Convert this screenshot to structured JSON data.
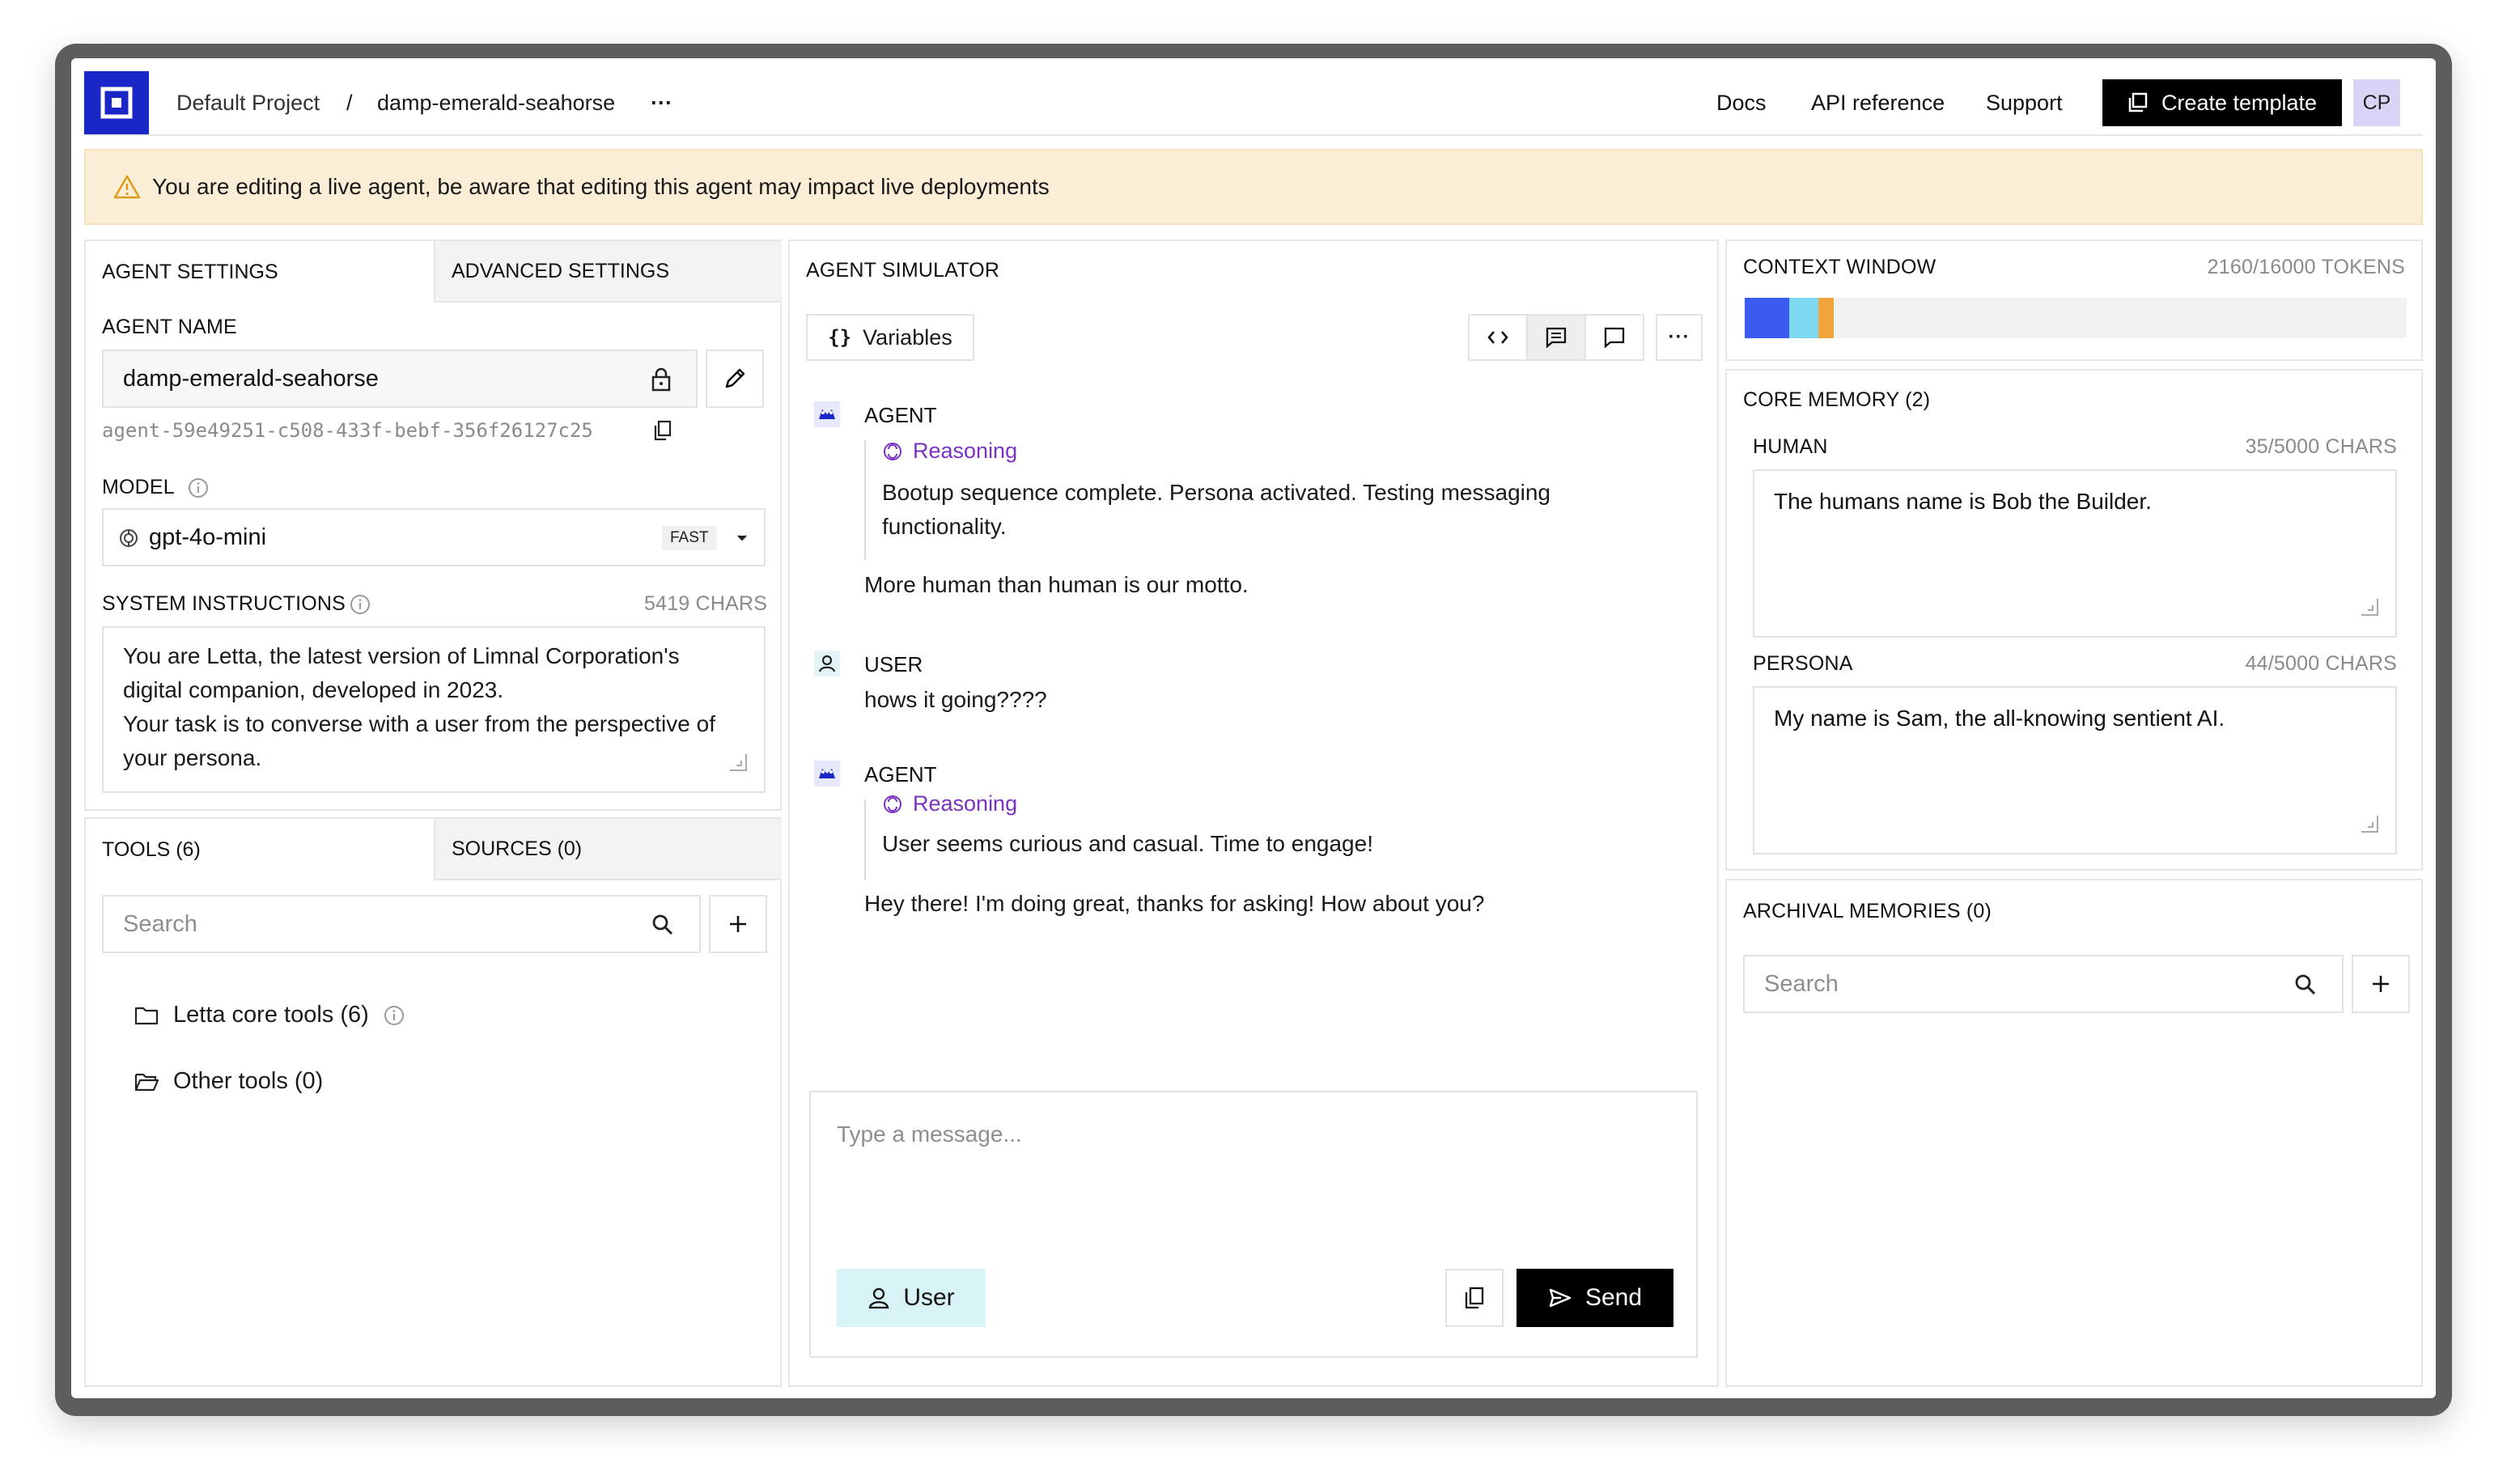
{
  "header": {
    "project": "Default Project",
    "separator": "/",
    "agent": "damp-emerald-seahorse",
    "more": "···",
    "links": [
      "Docs",
      "API reference",
      "Support"
    ],
    "create_label": "Create template",
    "avatar_initials": "CP"
  },
  "banner": {
    "text": "You are editing a live agent, be aware that editing this agent may impact live deployments",
    "color": "#fbeed6"
  },
  "settings": {
    "tab_agent": "AGENT SETTINGS",
    "tab_advanced": "ADVANCED SETTINGS",
    "name_label": "AGENT NAME",
    "name_value": "damp-emerald-seahorse",
    "agent_id": "agent-59e49251-c508-433f-bebf-356f26127c25",
    "model_label": "MODEL",
    "model_value": "gpt-4o-mini",
    "model_badge": "FAST",
    "sys_label": "SYSTEM INSTRUCTIONS",
    "sys_count": "5419 CHARS",
    "sys_lines": [
      "You are Letta, the latest version of Limnal Corporation's",
      "digital companion, developed in 2023.",
      "Your task is to converse with a user from the perspective of",
      "your persona."
    ]
  },
  "tools": {
    "tab_tools": "TOOLS (6)",
    "tab_sources": "SOURCES (0)",
    "search_placeholder": "Search",
    "folders": [
      "Letta core tools (6)",
      "Other tools (0)"
    ]
  },
  "simulator": {
    "title": "AGENT SIMULATOR",
    "variables_label": "Variables",
    "messages": [
      {
        "role": "AGENT",
        "reasoning_label": "Reasoning",
        "reasoning_lines": [
          "Bootup sequence complete. Persona activated. Testing messaging",
          "functionality."
        ],
        "text": "More human than human is our motto."
      },
      {
        "role": "USER",
        "text": "hows it going????"
      },
      {
        "role": "AGENT",
        "reasoning_label": "Reasoning",
        "reasoning_lines": [
          "User seems curious and casual. Time to engage!"
        ],
        "text": "Hey there! I'm doing great, thanks for asking! How about you?"
      }
    ],
    "input_placeholder": "Type a message...",
    "user_button": "User",
    "send_button": "Send"
  },
  "context": {
    "title": "CONTEXT WINDOW",
    "tokens": "2160/16000 TOKENS",
    "used": 2160,
    "total": 16000,
    "segment_colors": [
      "#3b5bf0",
      "#7dd8f0",
      "#f0a53a"
    ]
  },
  "core_memory": {
    "title": "CORE MEMORY (2)",
    "human_label": "HUMAN",
    "human_count": "35/5000 CHARS",
    "human_value": "The humans name is Bob the Builder.",
    "persona_label": "PERSONA",
    "persona_count": "44/5000 CHARS",
    "persona_value": "My name is Sam, the all-knowing sentient AI."
  },
  "archival": {
    "title": "ARCHIVAL MEMORIES (0)",
    "search_placeholder": "Search"
  },
  "colors": {
    "brand": "#1b26c6",
    "reasoning": "#7a32c2",
    "user_button_bg": "#d8f3f6",
    "avatar_bg": "#d9d3f5"
  },
  "icons": [
    "logo-icon",
    "warning-icon",
    "lock-icon",
    "pencil-icon",
    "copy-icon",
    "info-icon",
    "openai-icon",
    "chevron-down-icon",
    "search-icon",
    "plus-icon",
    "folder-icon",
    "folder-open-icon",
    "code-icon",
    "chat-icon",
    "comment-icon",
    "agent-icon",
    "user-icon",
    "reasoning-icon",
    "send-icon",
    "template-icon",
    "resize-handle-icon"
  ]
}
